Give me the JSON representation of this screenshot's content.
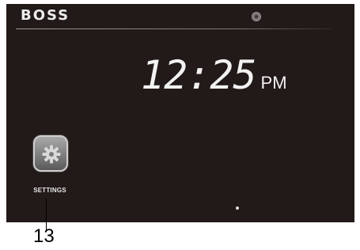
{
  "brand": {
    "text": "BOSS"
  },
  "clock": {
    "time": "12:25",
    "ampm": "PM"
  },
  "apps": [
    {
      "label": "SETTINGS",
      "icon": "gear-icon"
    }
  ],
  "callout": {
    "number": "13"
  },
  "colors": {
    "screen_bg": "#221a18",
    "text": "#f2f2f2",
    "tile": "#8a8a8a"
  }
}
